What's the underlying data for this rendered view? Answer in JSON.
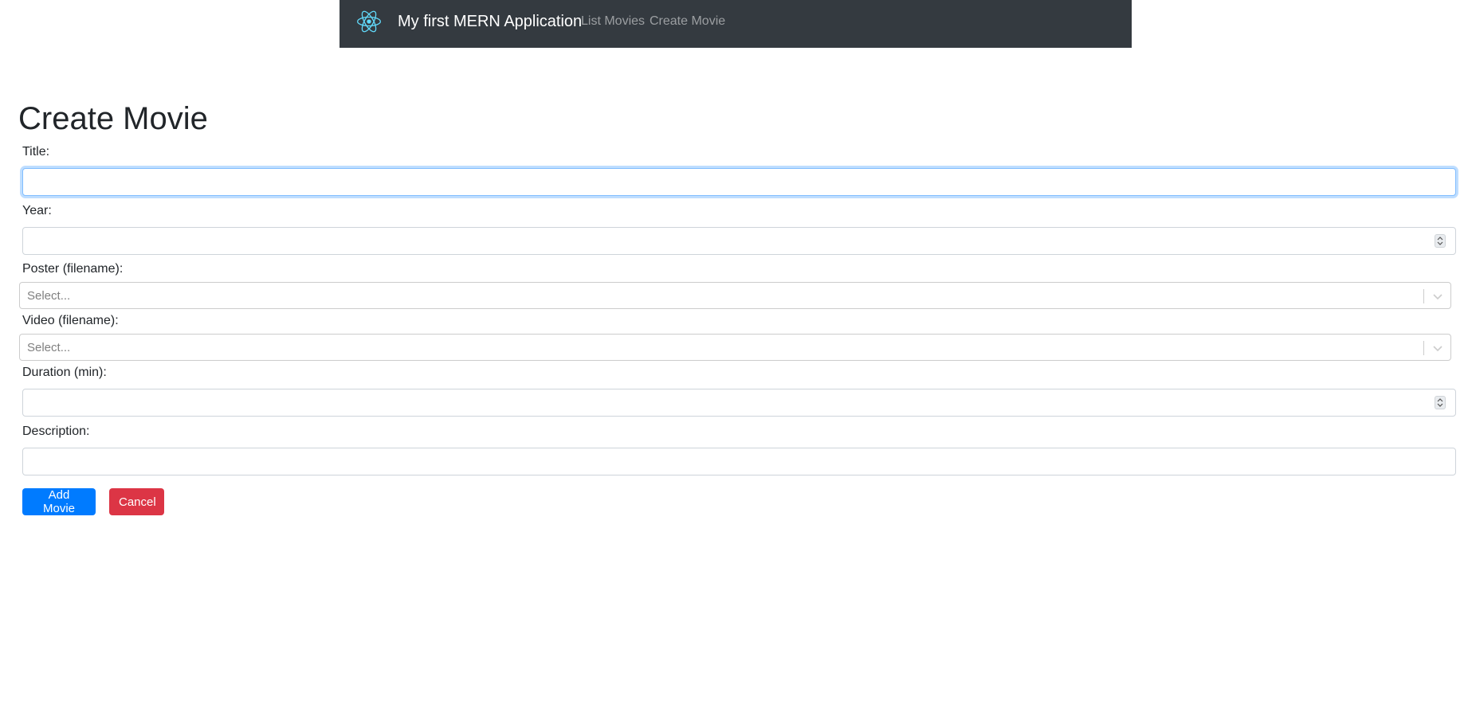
{
  "navbar": {
    "logo_icon": "react-atom-icon",
    "brand": "My first MERN Application",
    "links": [
      {
        "label": "List Movies"
      },
      {
        "label": "Create Movie"
      }
    ],
    "background": "#343a40"
  },
  "page": {
    "title": "Create Movie"
  },
  "form": {
    "title": {
      "label": "Title:",
      "value": ""
    },
    "year": {
      "label": "Year:",
      "value": ""
    },
    "poster": {
      "label": "Poster (filename):",
      "placeholder": "Select..."
    },
    "video": {
      "label": "Video (filename):",
      "placeholder": "Select..."
    },
    "duration": {
      "label": "Duration (min):",
      "value": ""
    },
    "description": {
      "label": "Description:",
      "value": ""
    }
  },
  "buttons": {
    "add": "Add Movie",
    "cancel": "Cancel"
  },
  "colors": {
    "primary": "#007bff",
    "danger": "#dc3545",
    "logo": "#61dafb"
  }
}
